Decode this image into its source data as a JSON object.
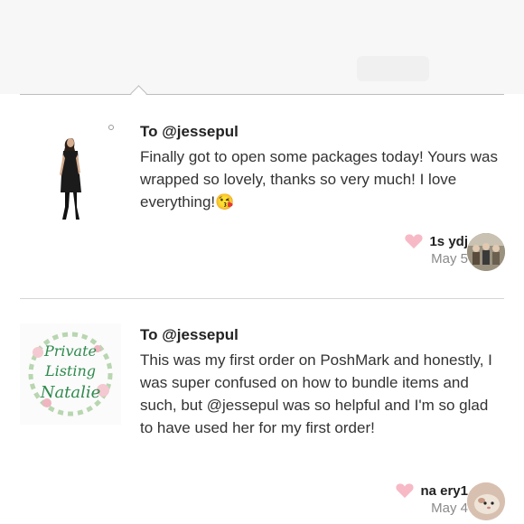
{
  "reviews": [
    {
      "to": "To @jessepul",
      "message": "Finally got to open some packages today! Yours was wrapped so lovely, thanks so very much! I love everything!😘",
      "username": "1s   ydj",
      "date": "May 5"
    },
    {
      "to": "To @jessepul",
      "message": "This was my first order on PoshMark and honestly, I was super confused on how to bundle items and such, but @jessepul was so helpful and I'm so glad to have used her for my first order!",
      "username": "na      ery1",
      "date": "May 4",
      "thumbnail_text": {
        "line1": "Private",
        "line2": "Listing",
        "line3": "Natalie"
      }
    }
  ],
  "colors": {
    "heart": "#f7b9c6",
    "divider": "#d5d5d5",
    "date_gray": "#8a8a8a"
  }
}
